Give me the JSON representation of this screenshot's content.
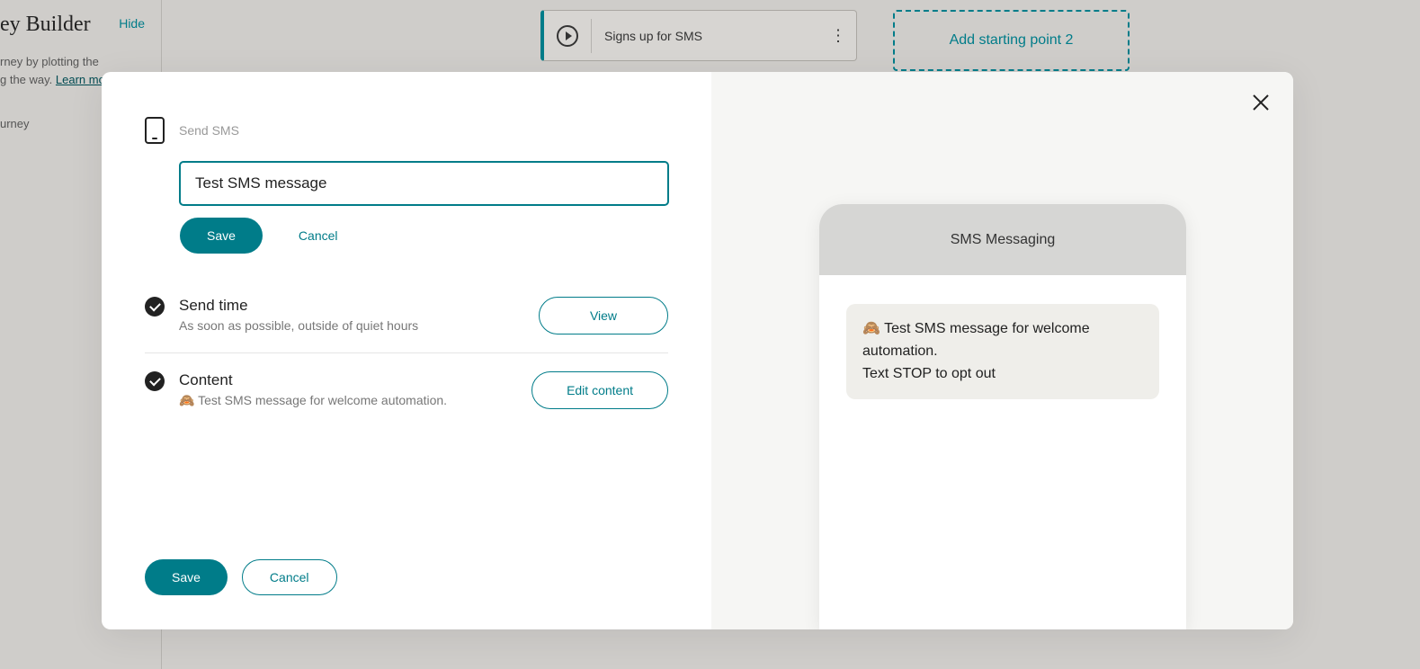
{
  "background": {
    "sidebar_title": "ey Builder",
    "hide_label": "Hide",
    "desc_line1": "rney by plotting the",
    "desc_line2": "g the way. ",
    "learn_more_partial": "Learn mo",
    "subtext": "urney",
    "card_text": "Signs up for SMS",
    "add_point_label": "Add starting point 2"
  },
  "modal": {
    "header_label": "Send SMS",
    "name_value": "Test SMS message",
    "save_inline": "Save",
    "cancel_inline": "Cancel",
    "sections": {
      "send_time": {
        "title": "Send time",
        "subtitle": "As soon as possible, outside of quiet hours",
        "button": "View"
      },
      "content": {
        "title": "Content",
        "subtitle": "🙈 Test SMS message for welcome automation.",
        "button": "Edit content"
      }
    },
    "footer_save": "Save",
    "footer_cancel": "Cancel"
  },
  "preview": {
    "header": "SMS Messaging",
    "bubble_line1": "🙈 Test SMS message for welcome automation.",
    "bubble_line2": "Text STOP to opt out"
  }
}
